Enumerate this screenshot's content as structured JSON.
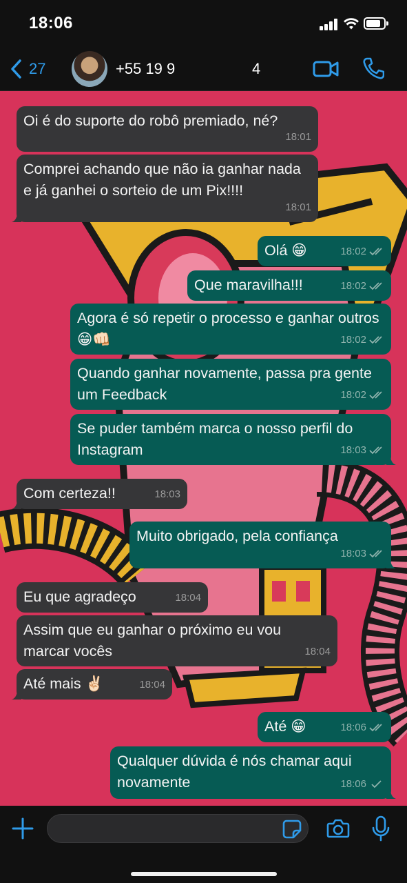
{
  "status_bar": {
    "time": "18:06"
  },
  "header": {
    "back_count": "27",
    "contact_name": "+55 19 9",
    "contact_extra": "4"
  },
  "messages": [
    {
      "dir": "in",
      "text": "Oi é do suporte do robô premiado, né?",
      "time": "18:01"
    },
    {
      "dir": "in",
      "text": "Comprei achando que não ia ganhar nada e já ganhei o sorteio de um Pix!!!!",
      "time": "18:01"
    },
    {
      "dir": "out",
      "text": "Olá 😁",
      "time": "18:02",
      "ticks": "read"
    },
    {
      "dir": "out",
      "text": "Que maravilha!!!",
      "time": "18:02",
      "ticks": "read"
    },
    {
      "dir": "out",
      "text": "Agora é só repetir o processo e ganhar outros 😁👊🏻",
      "time": "18:02",
      "ticks": "read"
    },
    {
      "dir": "out",
      "text": "Quando ganhar novamente, passa pra gente um Feedback",
      "time": "18:02",
      "ticks": "read"
    },
    {
      "dir": "out",
      "text": "Se puder também marca o nosso perfil do Instagram",
      "time": "18:03",
      "ticks": "read"
    },
    {
      "dir": "in",
      "text": "Com certeza!!",
      "time": "18:03"
    },
    {
      "dir": "out",
      "text": "Muito obrigado, pela confiança",
      "time": "18:03",
      "ticks": "read"
    },
    {
      "dir": "in",
      "text": "Eu que agradeço",
      "time": "18:04"
    },
    {
      "dir": "in",
      "text": "Assim que eu ganhar o próximo eu vou marcar vocês",
      "time": "18:04"
    },
    {
      "dir": "in",
      "text": "Até mais ✌🏻",
      "time": "18:04"
    },
    {
      "dir": "out",
      "text": "Até 😁",
      "time": "18:06",
      "ticks": "read"
    },
    {
      "dir": "out",
      "text": "Qualquer dúvida é nós chamar aqui novamente",
      "time": "18:06",
      "ticks": "sent"
    }
  ],
  "input": {
    "placeholder": ""
  },
  "colors": {
    "accent": "#2f9be9",
    "chat_background": "#d7335a",
    "incoming_bubble": "#363638",
    "outgoing_bubble": "#065b54"
  },
  "icons": [
    "back-chevron-icon",
    "video-call-icon",
    "phone-icon",
    "plus-icon",
    "sticker-icon",
    "camera-icon",
    "microphone-icon",
    "double-check-icon",
    "single-check-icon"
  ]
}
